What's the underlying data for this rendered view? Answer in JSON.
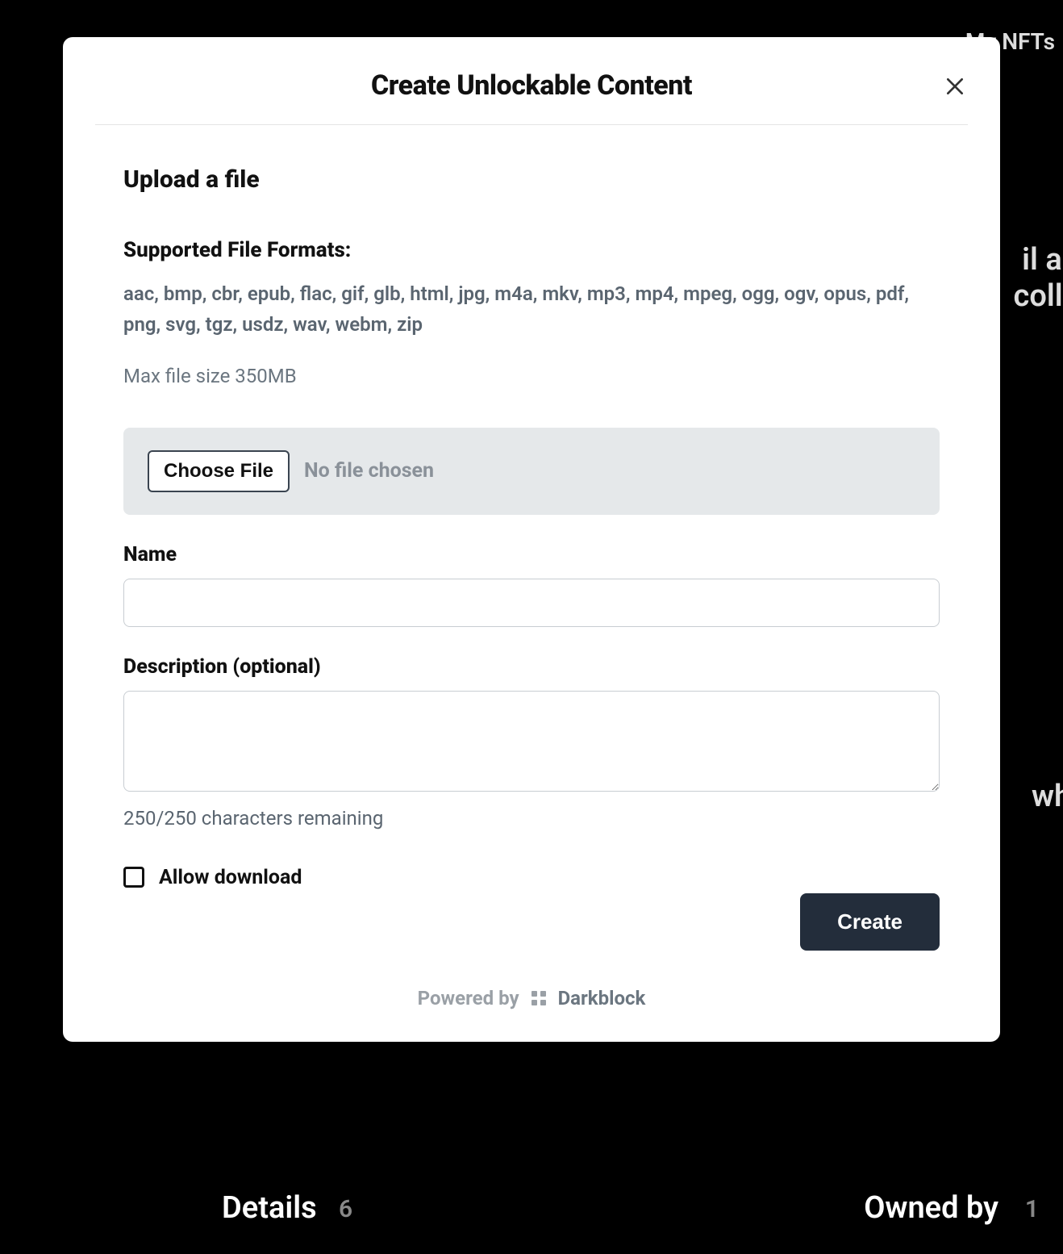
{
  "background": {
    "top_right": "My NFTs",
    "mid_right1": "il allo",
    "mid_right2": "colla",
    "mid_right3": "whic",
    "bottom_left_label": "Details",
    "bottom_left_count": "6",
    "bottom_right_label": "Owned by",
    "bottom_right_count": "1"
  },
  "modal": {
    "title": "Create Unlockable Content",
    "section_title": "Upload a file",
    "formats_label": "Supported File Formats:",
    "formats_list": "aac, bmp, cbr, epub, flac, gif, glb, html, jpg, m4a, mkv, mp3, mp4, mpeg, ogg, ogv, opus, pdf, png, svg, tgz, usdz, wav, webm, zip",
    "max_file_size": "Max file size 350MB",
    "choose_file_label": "Choose File",
    "file_status": "No file chosen",
    "name_label": "Name",
    "name_value": "",
    "description_label": "Description (optional)",
    "description_value": "",
    "char_count": "250/250 characters remaining",
    "allow_download_label": "Allow download",
    "create_label": "Create",
    "powered_by_label": "Powered by",
    "powered_by_brand": "Darkblock"
  }
}
